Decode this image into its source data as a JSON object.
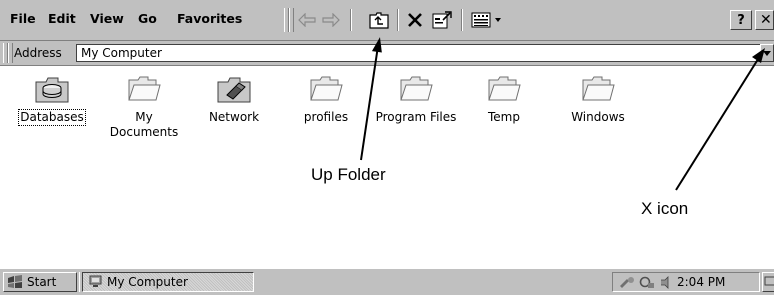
{
  "menu": {
    "items": [
      "File",
      "Edit",
      "View",
      "Go",
      "Favorites"
    ]
  },
  "toolbar": {
    "help_label": "?",
    "close_label": "✕"
  },
  "address": {
    "label": "Address",
    "value": "My Computer"
  },
  "icons": [
    {
      "label": "Databases",
      "icon": "database-icon",
      "selected": true
    },
    {
      "label": "My Documents",
      "icon": "folder-icon"
    },
    {
      "label": "Network",
      "icon": "network-icon"
    },
    {
      "label": "profiles",
      "icon": "folder-icon"
    },
    {
      "label": "Program Files",
      "icon": "folder-icon"
    },
    {
      "label": "Temp",
      "icon": "folder-icon"
    },
    {
      "label": "Windows",
      "icon": "folder-icon"
    }
  ],
  "annotations": {
    "up_folder": "Up Folder",
    "x_icon": "X icon"
  },
  "taskbar": {
    "start_label": "Start",
    "task_label": "My Computer",
    "clock": "2:04 PM"
  }
}
